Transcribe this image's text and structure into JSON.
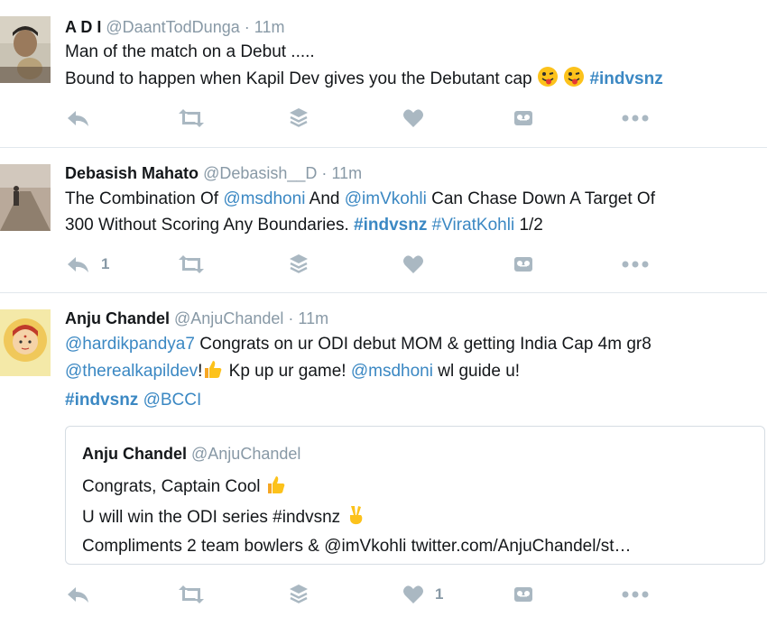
{
  "tweets": [
    {
      "name": "A D I",
      "handle": "@DaantTodDunga",
      "dot": "·",
      "time": "11m",
      "line1": "Man of the match on a Debut .....",
      "line2_text": "Bound to happen when Kapil Dev gives you the Debutant cap",
      "line2_tag": "#indvsnz",
      "reply_count": ""
    },
    {
      "name": "Debasish Mahato",
      "handle": "@Debasish__D",
      "dot": "·",
      "time": "11m",
      "l1_a": "The Combination Of ",
      "l1_mention1": "@msdhoni",
      "l1_b": " And ",
      "l1_mention2": "@imVkohli",
      "l1_c": " Can Chase Down A Target Of",
      "l2_a": "300 Without Scoring Any Boundaries. ",
      "l2_tag1": "#indvsnz",
      "l2_tag2": "#ViratKohli",
      "l2_b": " 1/2",
      "reply_count": "1"
    },
    {
      "name": "Anju Chandel",
      "handle": "@AnjuChandel",
      "dot": "·",
      "time": "11m",
      "l1_mention": "@hardikpandya7",
      "l1_text": " Congrats on ur ODI debut MOM & getting India Cap 4m gr8",
      "l2_mention1": "@therealkapildev",
      "l2_a": "!",
      "l2_b": " Kp up ur game! ",
      "l2_mention2": "@msdhoni",
      "l2_c": " wl guide u!",
      "l3_tag": "#indvsnz",
      "l3_mention": "@BCCI",
      "like_count": "1",
      "quote": {
        "name": "Anju Chandel",
        "handle": "@AnjuChandel",
        "line1": "Congrats, Captain Cool",
        "line2": "U will win the ODI series #indvsnz",
        "line3": "Compliments 2 team bowlers & @imVkohli twitter.com/AnjuChandel/st…"
      }
    }
  ],
  "icons": [
    "reply-icon",
    "retweet-icon",
    "buffer-icon",
    "like-icon",
    "tape-icon",
    "more-icon"
  ],
  "colors": {
    "link": "#3b88c3",
    "muted": "#8899a6",
    "icon": "#aab8c2",
    "divider": "#e1e8ed"
  }
}
